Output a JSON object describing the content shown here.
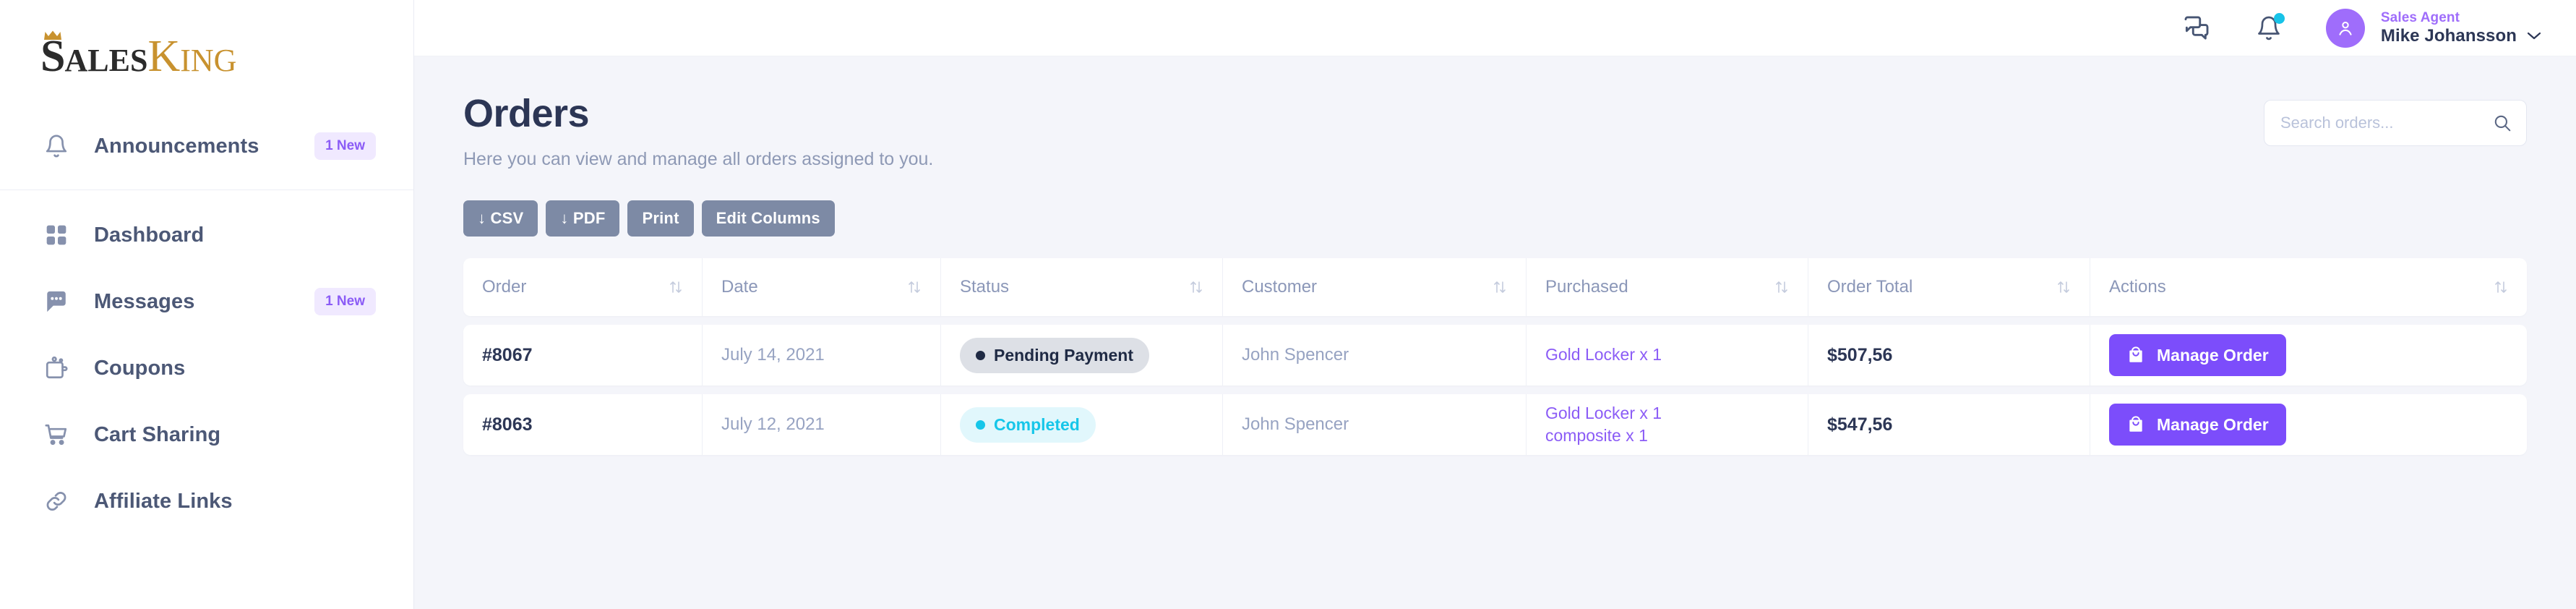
{
  "brand": {
    "logo_sales_first": "S",
    "logo_sales_rest": "ALES",
    "logo_king_first": "K",
    "logo_king_rest": "ING",
    "color_dark": "#2b2b2b",
    "color_gold": "#c8922f"
  },
  "sidebar": {
    "top_items": [
      {
        "label": "Announcements",
        "badge": "1 New",
        "icon": "bell-icon"
      }
    ],
    "items": [
      {
        "label": "Dashboard",
        "badge": "",
        "icon": "grid-icon"
      },
      {
        "label": "Messages",
        "badge": "1 New",
        "icon": "chat-bubble-icon"
      },
      {
        "label": "Coupons",
        "badge": "",
        "icon": "wallet-icon"
      },
      {
        "label": "Cart Sharing",
        "badge": "",
        "icon": "shopping-cart-icon"
      },
      {
        "label": "Affiliate Links",
        "badge": "",
        "icon": "link-icon"
      }
    ],
    "badge_bg": "#f0e9ff",
    "badge_color": "#8b5cf6"
  },
  "topbar": {
    "chat_icon": "chat-icon",
    "bell_icon": "bell-icon",
    "notification_dot_color": "#17c3e8",
    "user_role": "Sales Agent",
    "user_name": "Mike Johansson",
    "avatar_icon": "user-icon",
    "avatar_color": "#9f6dfb"
  },
  "page": {
    "title": "Orders",
    "subtitle": "Here you can view and manage all orders assigned to you."
  },
  "search": {
    "placeholder": "Search orders...",
    "value": ""
  },
  "toolbar": {
    "csv_label": "↓ CSV",
    "pdf_label": "↓ PDF",
    "print_label": "Print",
    "edit_columns_label": "Edit Columns",
    "button_color": "#7d8aa5"
  },
  "table": {
    "columns": [
      {
        "label": "Order"
      },
      {
        "label": "Date"
      },
      {
        "label": "Status"
      },
      {
        "label": "Customer"
      },
      {
        "label": "Purchased"
      },
      {
        "label": "Order Total"
      },
      {
        "label": "Actions"
      }
    ],
    "rows": [
      {
        "order": "#8067",
        "date": "July 14, 2021",
        "status": "Pending Payment",
        "status_type": "pending",
        "customer": "John Spencer",
        "purchased": [
          "Gold Locker x 1"
        ],
        "total": "$507,56",
        "action_label": "Manage Order"
      },
      {
        "order": "#8063",
        "date": "July 12, 2021",
        "status": "Completed",
        "status_type": "completed",
        "customer": "John Spencer",
        "purchased": [
          "Gold Locker x 1",
          "composite x 1"
        ],
        "total": "$547,56",
        "action_label": "Manage Order"
      }
    ],
    "status_colors": {
      "pending_bg": "#dde0e6",
      "pending_text": "#1f2a44",
      "completed_bg": "#e1f7fc",
      "completed_text": "#16c6e9"
    },
    "action_button_color": "#7c4dfb",
    "purchased_link_color": "#8b5cf6"
  }
}
